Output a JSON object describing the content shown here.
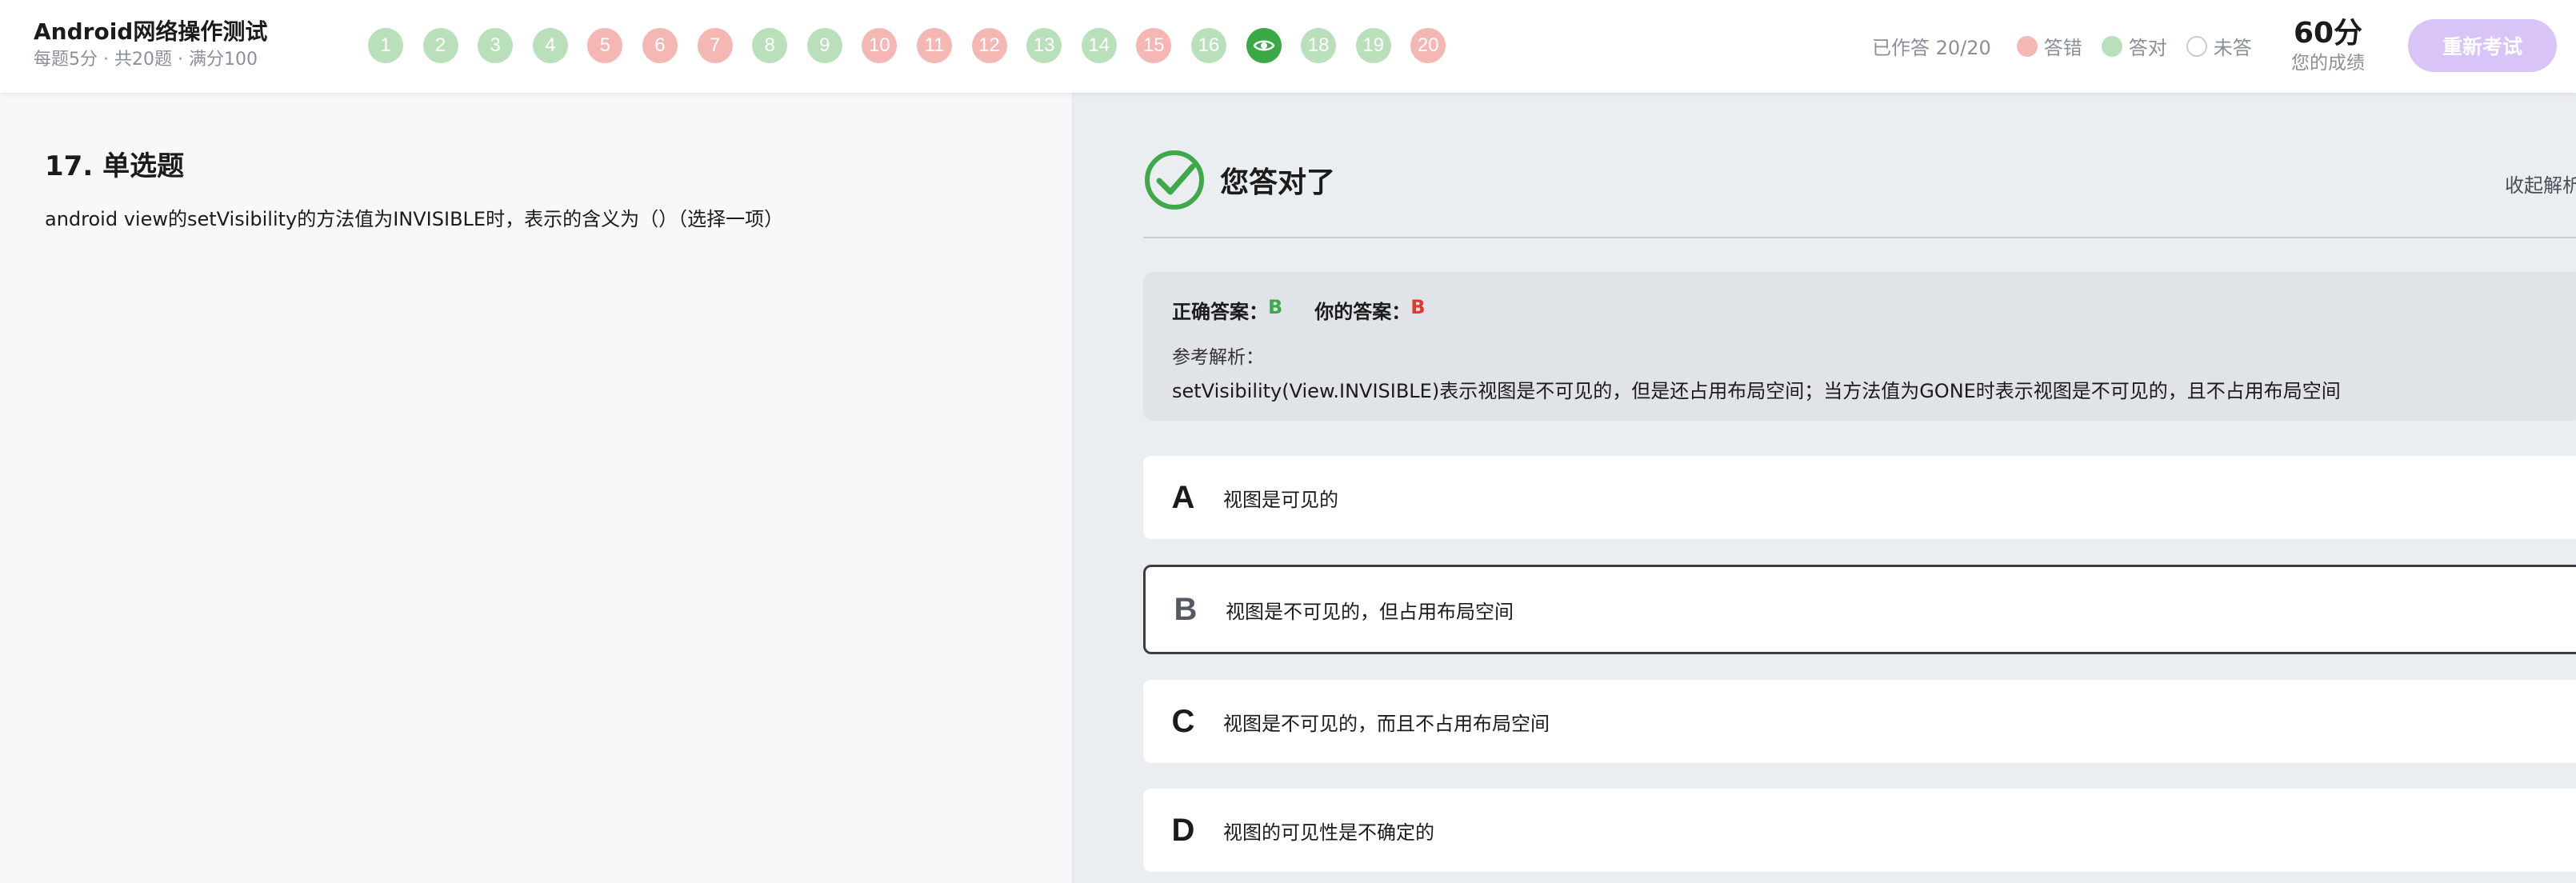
{
  "header": {
    "title": "Android网络操作测试",
    "meta": "每题5分 · 共20题 · 满分100",
    "questions": [
      {
        "label": "1",
        "status": "correct"
      },
      {
        "label": "2",
        "status": "correct"
      },
      {
        "label": "3",
        "status": "correct"
      },
      {
        "label": "4",
        "status": "correct"
      },
      {
        "label": "5",
        "status": "wrong"
      },
      {
        "label": "6",
        "status": "wrong"
      },
      {
        "label": "7",
        "status": "wrong"
      },
      {
        "label": "8",
        "status": "correct"
      },
      {
        "label": "9",
        "status": "correct"
      },
      {
        "label": "10",
        "status": "wrong"
      },
      {
        "label": "11",
        "status": "wrong"
      },
      {
        "label": "12",
        "status": "wrong"
      },
      {
        "label": "13",
        "status": "correct"
      },
      {
        "label": "14",
        "status": "correct"
      },
      {
        "label": "15",
        "status": "wrong"
      },
      {
        "label": "16",
        "status": "correct"
      },
      {
        "label": "17",
        "status": "current",
        "icon": "eye-icon"
      },
      {
        "label": "18",
        "status": "correct"
      },
      {
        "label": "19",
        "status": "correct"
      },
      {
        "label": "20",
        "status": "wrong"
      }
    ],
    "answered": "已作答 20/20",
    "legend_wrong": "答错",
    "legend_correct": "答对",
    "legend_unanswered": "未答",
    "score": "60分",
    "score_label": "您的成绩",
    "retake": "重新考试"
  },
  "question": {
    "heading": "17. 单选题",
    "text": "android view的setVisibility的方法值为INVISIBLE时，表示的含义为（）（选择一项）"
  },
  "result": {
    "text": "您答对了",
    "collapse": "收起解析",
    "correct_label": "正确答案：",
    "correct_value": "B",
    "your_label": "你的答案：",
    "your_value": "B",
    "ref_label": "参考解析：",
    "ref_text": "setVisibility(View.INVISIBLE)表示视图是不可见的，但是还占用布局空间；当方法值为GONE时表示视图是不可见的，且不占用布局空间"
  },
  "options": [
    {
      "letter": "A",
      "text": "视图是可见的"
    },
    {
      "letter": "B",
      "text": "视图是不可见的，但占用布局空间",
      "selected": true
    },
    {
      "letter": "C",
      "text": "视图是不可见的，而且不占用布局空间"
    },
    {
      "letter": "D",
      "text": "视图的可见性是不确定的"
    }
  ],
  "colors": {
    "correct": "#b9e0bb",
    "wrong": "#f4b7b4",
    "current": "#39a845",
    "retake_button": "#d8c4f7"
  }
}
